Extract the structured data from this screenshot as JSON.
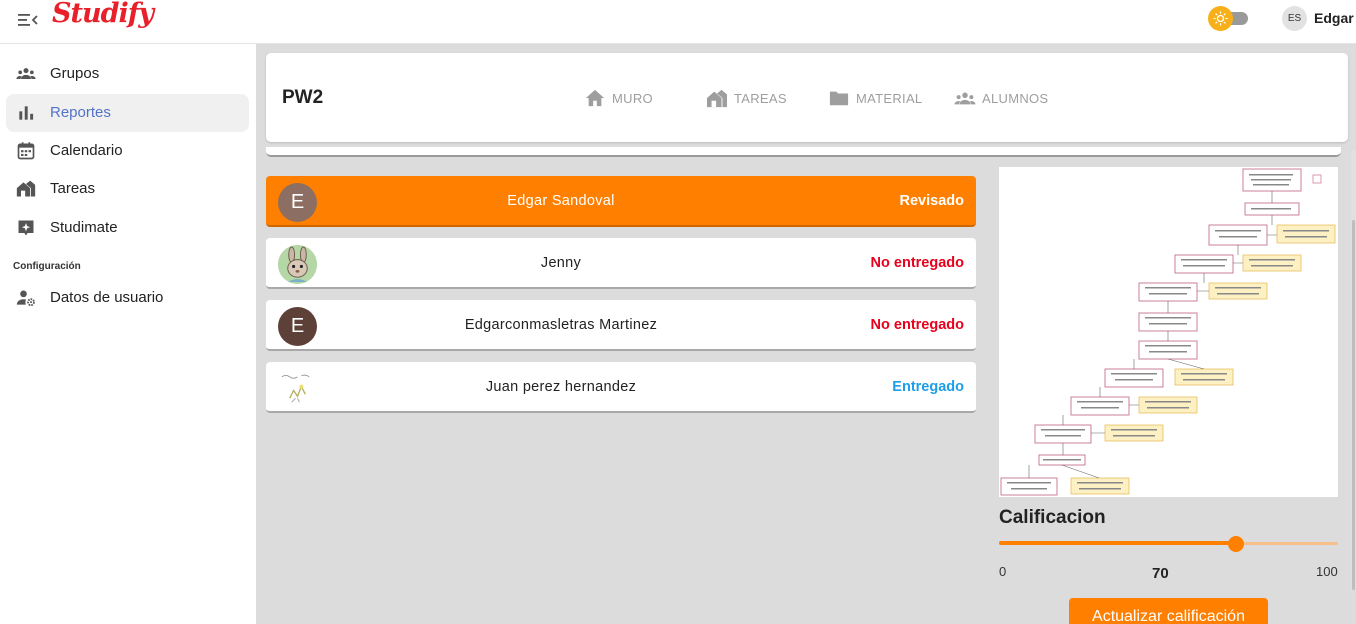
{
  "app": {
    "brand": "Studify",
    "user_initials": "ES",
    "user_name": "Edgar"
  },
  "sidebar": {
    "items": [
      {
        "label": "Grupos",
        "icon": "groups-icon"
      },
      {
        "label": "Reportes",
        "icon": "bar-chart-icon",
        "active": true
      },
      {
        "label": "Calendario",
        "icon": "calendar-icon"
      },
      {
        "label": "Tareas",
        "icon": "homework-icon"
      },
      {
        "label": "Studimate",
        "icon": "sparkle-chat-icon"
      }
    ],
    "section_label": "Configuración",
    "settings_items": [
      {
        "label": "Datos de usuario",
        "icon": "user-settings-icon"
      }
    ]
  },
  "class_header": {
    "title": "PW2",
    "tabs": [
      {
        "label": "MURO",
        "icon": "home-icon"
      },
      {
        "label": "TAREAS",
        "icon": "homework-icon"
      },
      {
        "label": "MATERIAL",
        "icon": "folder-icon"
      },
      {
        "label": "ALUMNOS",
        "icon": "students-icon"
      }
    ]
  },
  "submissions": [
    {
      "name": "Edgar Sandoval",
      "status": "Revisado",
      "avatar_letter": "E",
      "selected": true,
      "status_color": "#ffffff",
      "avatar_color": "#8d6e63"
    },
    {
      "name": "Jenny",
      "status": "No entregado",
      "avatar_letter": "",
      "avatar_image": "rabbit",
      "status_color": "#e8001c"
    },
    {
      "name": "Edgarconmasletras Martinez",
      "status": "No entregado",
      "avatar_letter": "E",
      "status_color": "#e8001c",
      "avatar_color": "#5d4037"
    },
    {
      "name": "Juan perez hernandez",
      "status": "Entregado",
      "avatar_letter": "",
      "avatar_image": "sketch",
      "status_color": "#1e9ee8"
    }
  ],
  "grading": {
    "title": "Calificacion",
    "min": "0",
    "max": "100",
    "value": 70,
    "value_label": "70",
    "button": "Actualizar calificación",
    "accent": "#ff7f00"
  }
}
